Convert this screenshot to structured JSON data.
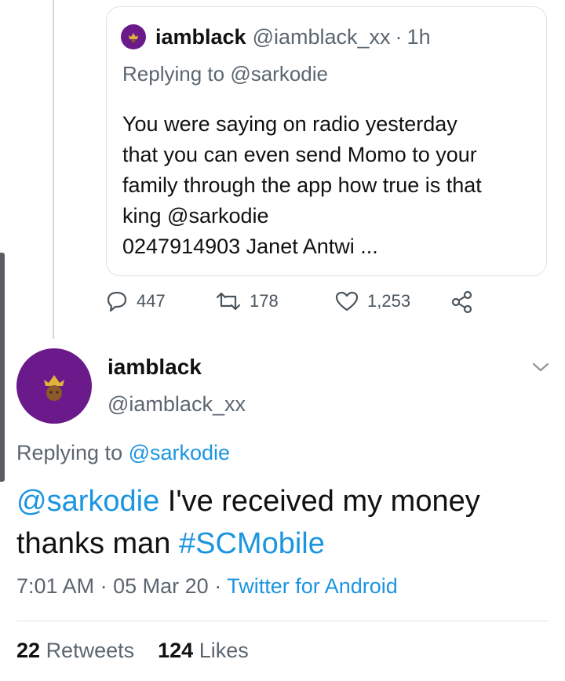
{
  "quoted_tweet": {
    "display_name": "iamblack",
    "handle": "@iamblack_xx",
    "separator": "·",
    "time_ago": "1h",
    "replying_prefix": "Replying to",
    "replying_to": "@sarkodie",
    "body_lines": [
      "You were saying on radio yesterday",
      "that you can even send Momo to your",
      "family through the app how true is that",
      "king @sarkodie",
      "0247914903 Janet Antwi ..."
    ]
  },
  "actions": {
    "replies": "447",
    "retweets": "178",
    "likes": "1,253"
  },
  "main_tweet": {
    "display_name": "iamblack",
    "handle": "@iamblack_xx",
    "replying_prefix": "Replying to",
    "replying_to": "@sarkodie",
    "text_line1_mention": "@sarkodie",
    "text_line1_rest": " I've received my money",
    "text_line2_rest": "thanks man ",
    "text_line2_hashtag": "#SCMobile",
    "time": "7:01 AM",
    "separator": "·",
    "date": "05 Mar 20",
    "source": "Twitter for Android",
    "retweet_count": "22",
    "retweet_label": "Retweets",
    "like_count": "124",
    "like_label": "Likes"
  },
  "colors": {
    "link": "#1b95e0",
    "avatar_bg": "#6a1a8a",
    "muted_text": "#5b6670"
  },
  "icons": {
    "reply": "reply-icon",
    "retweet": "retweet-icon",
    "like": "heart-icon",
    "share": "share-icon",
    "more": "chevron-down-icon"
  }
}
